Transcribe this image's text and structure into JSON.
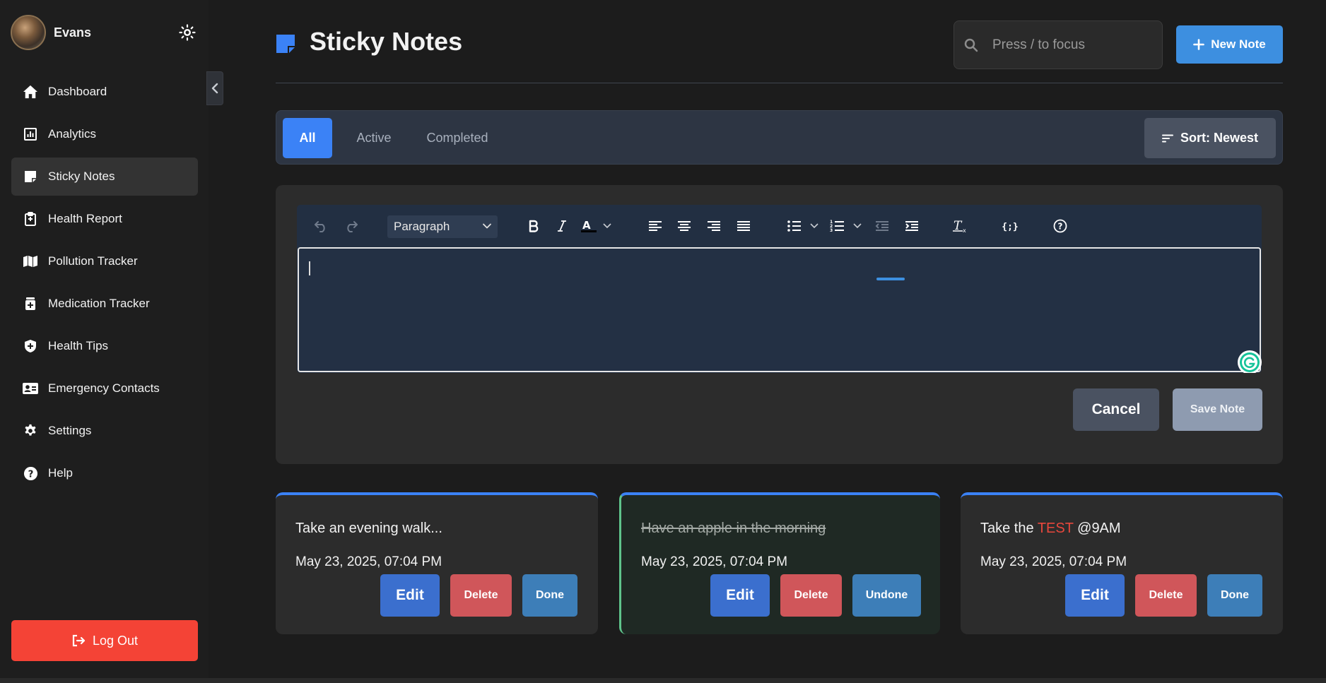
{
  "sidebar": {
    "user_name": "Evans",
    "items": [
      {
        "label": "Dashboard",
        "icon": "home-icon"
      },
      {
        "label": "Analytics",
        "icon": "analytics-icon"
      },
      {
        "label": "Sticky Notes",
        "icon": "sticky-note-icon",
        "active": true
      },
      {
        "label": "Health Report",
        "icon": "clipboard-icon"
      },
      {
        "label": "Pollution Tracker",
        "icon": "map-icon"
      },
      {
        "label": "Medication Tracker",
        "icon": "medicine-icon"
      },
      {
        "label": "Health Tips",
        "icon": "shield-plus-icon"
      },
      {
        "label": "Emergency Contacts",
        "icon": "contact-card-icon"
      },
      {
        "label": "Settings",
        "icon": "gear-icon"
      },
      {
        "label": "Help",
        "icon": "help-icon"
      }
    ],
    "logout_label": "Log Out"
  },
  "header": {
    "title": "Sticky Notes",
    "search_placeholder": "Press / to focus",
    "new_note_label": "New Note"
  },
  "filters": {
    "tabs": [
      "All",
      "Active",
      "Completed"
    ],
    "active_tab": "All",
    "sort_label": "Sort: Newest"
  },
  "editor": {
    "block_format": "Paragraph",
    "content": "",
    "cancel_label": "Cancel",
    "save_label": "Save Note"
  },
  "notes": [
    {
      "text": "Take an evening walk...",
      "date": "May 23, 2025, 07:04 PM",
      "completed": false,
      "buttons": [
        "Edit",
        "Delete",
        "Done"
      ]
    },
    {
      "text": "Have an apple in the morning",
      "date": "May 23, 2025, 07:04 PM",
      "completed": true,
      "buttons": [
        "Edit",
        "Delete",
        "Undone"
      ]
    },
    {
      "text_before": "Take the ",
      "text_highlight": "TEST",
      "text_after": " @9AM",
      "date": "May 23, 2025, 07:04 PM",
      "completed": false,
      "buttons": [
        "Edit",
        "Delete",
        "Done"
      ]
    }
  ],
  "colors": {
    "accent": "#3b82f6",
    "new_note": "#3d8fe0",
    "logout": "#f44336",
    "delete": "#d0565a",
    "highlight": "#e8473c",
    "completed_border": "#5fc48c"
  }
}
